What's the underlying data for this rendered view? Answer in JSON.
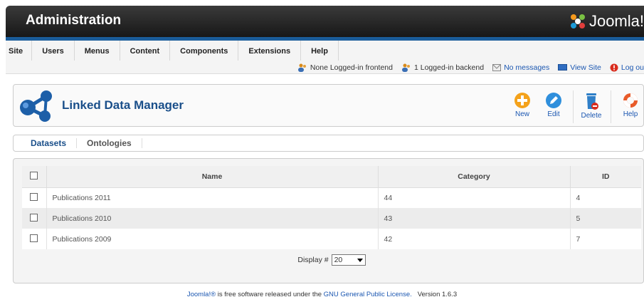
{
  "header": {
    "title": "Administration",
    "logo_text": "Joomla!"
  },
  "menu": {
    "items": [
      "Site",
      "Users",
      "Menus",
      "Content",
      "Components",
      "Extensions",
      "Help"
    ]
  },
  "status": {
    "frontend": "None Logged-in frontend",
    "backend": "1 Logged-in backend",
    "messages": "No messages",
    "view_site": "View Site",
    "logout": "Log ou"
  },
  "toolbar": {
    "component_title": "Linked Data Manager",
    "new_label": "New",
    "edit_label": "Edit",
    "delete_label": "Delete",
    "help_label": "Help"
  },
  "tabs": [
    "Datasets",
    "Ontologies"
  ],
  "table": {
    "headers": {
      "name": "Name",
      "category": "Category",
      "id": "ID"
    },
    "rows": [
      {
        "name": "Publications 2011",
        "category": "44",
        "id": "4"
      },
      {
        "name": "Publications 2010",
        "category": "43",
        "id": "5"
      },
      {
        "name": "Publications 2009",
        "category": "42",
        "id": "7"
      }
    ]
  },
  "pagination": {
    "display_label": "Display #",
    "display_value": "20"
  },
  "footer": {
    "joomla_link": "Joomla!®",
    "text1": " is free software released under the ",
    "license_link": "GNU General Public License.",
    "version": "Version 1.6.3"
  },
  "colors": {
    "brand_blue": "#1a5c9a",
    "link_blue": "#1b57b1",
    "new_orange": "#f4a21b",
    "edit_blue": "#2f8fdc",
    "logout_red": "#d92b1c"
  }
}
